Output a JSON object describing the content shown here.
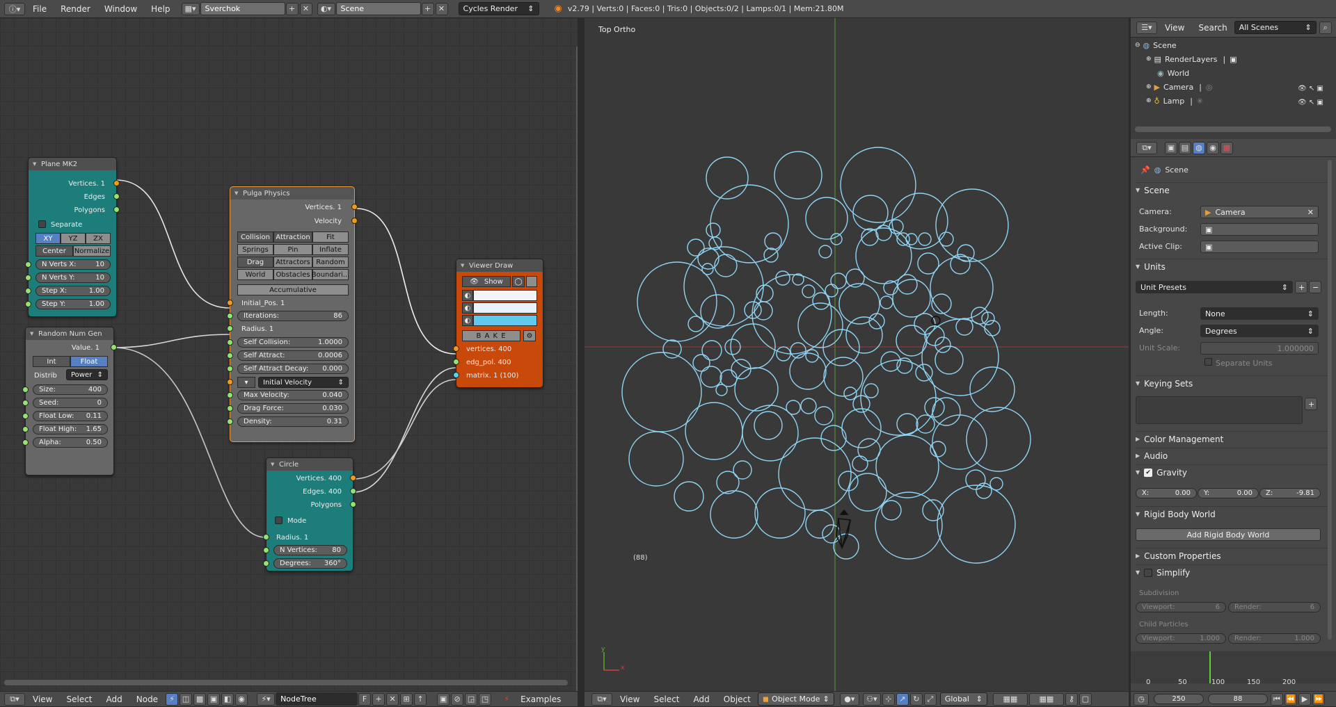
{
  "topbar": {
    "menus": [
      "File",
      "Render",
      "Window",
      "Help"
    ],
    "layout": "Sverchok",
    "scene": "Scene",
    "engine": "Cycles Render",
    "stats": "v2.79 | Verts:0 | Faces:0 | Tris:0 | Objects:0/2 | Lamps:0/1 | Mem:21.80M"
  },
  "nodes": {
    "plane": {
      "title": "Plane MK2",
      "outputs": [
        "Vertices. 1",
        "Edges",
        "Polygons"
      ],
      "separate": "Separate",
      "axes": [
        "XY",
        "YZ",
        "ZX"
      ],
      "modes": [
        "Center",
        "Normalize"
      ],
      "fields": [
        {
          "label": "N Verts X:",
          "value": "10"
        },
        {
          "label": "N Verts Y:",
          "value": "10"
        },
        {
          "label": "Step X:",
          "value": "1.00"
        },
        {
          "label": "Step Y:",
          "value": "1.00"
        }
      ]
    },
    "random": {
      "title": "Random Num Gen",
      "output": "Value. 1",
      "types": [
        "Int",
        "Float"
      ],
      "distrib_label": "Distrib",
      "distrib_value": "Power",
      "fields": [
        {
          "label": "Size:",
          "value": "400"
        },
        {
          "label": "Seed:",
          "value": "0"
        },
        {
          "label": "Float Low:",
          "value": "0.11"
        },
        {
          "label": "Float High:",
          "value": "1.65"
        },
        {
          "label": "Alpha:",
          "value": "0.50"
        }
      ]
    },
    "pulga": {
      "title": "Pulga Physics",
      "outputs": [
        "Vertices. 1",
        "Velocity"
      ],
      "grid": [
        [
          "Collision",
          "Attraction",
          "Fit"
        ],
        [
          "Springs",
          "Pin",
          "Inflate"
        ],
        [
          "Drag",
          "Attractors",
          "Random"
        ],
        [
          "World",
          "Obstacles",
          "Boundari..."
        ]
      ],
      "accumulative": "Accumulative",
      "initial_pos": "Initial_Pos. 1",
      "radius": "Radius. 1",
      "fields": [
        {
          "label": "Iterations:",
          "value": "86"
        },
        {
          "label": "Self Collision:",
          "value": "1.0000"
        },
        {
          "label": "Self Attract:",
          "value": "0.0006"
        },
        {
          "label": "Self Attract Decay:",
          "value": "0.000"
        }
      ],
      "init_vel": "Initial Velocity",
      "fields2": [
        {
          "label": "Max Velocity:",
          "value": "0.040"
        },
        {
          "label": "Drag Force:",
          "value": "0.030"
        },
        {
          "label": "Density:",
          "value": "0.31"
        }
      ]
    },
    "viewer": {
      "title": "Viewer Draw",
      "show": "Show",
      "bake": "B A K E",
      "inputs": [
        "vertices. 400",
        "edg_pol. 400",
        "matrix. 1 (100)"
      ]
    },
    "circle": {
      "title": "Circle",
      "outputs": [
        "Vertices. 400",
        "Edges. 400",
        "Polygons"
      ],
      "mode": "Mode",
      "radius": "Radius. 1",
      "fields": [
        {
          "label": "N Vertices:",
          "value": "80"
        },
        {
          "label": "Degrees:",
          "value": "360°"
        }
      ]
    }
  },
  "node_footer": {
    "menus": [
      "View",
      "Select",
      "Add",
      "Node"
    ],
    "tree": "NodeTree",
    "fake": "F",
    "examples": "Examples"
  },
  "viewport": {
    "label": "Top Ortho",
    "frame": "(88)",
    "menus": [
      "View",
      "Select",
      "Add",
      "Object"
    ],
    "mode": "Object Mode",
    "orientation": "Global",
    "circle_color": "#8fd4f2"
  },
  "outliner": {
    "menus": [
      "View",
      "Search"
    ],
    "filter": "All Scenes",
    "items": [
      "Scene",
      "RenderLayers",
      "World",
      "Camera",
      "Lamp"
    ]
  },
  "properties": {
    "scene_path": "Scene",
    "scene_panel": "Scene",
    "camera_label": "Camera:",
    "camera_value": "Camera",
    "background_label": "Background:",
    "clip_label": "Active Clip:",
    "units_panel": "Units",
    "unit_presets": "Unit Presets",
    "length_label": "Length:",
    "length_value": "None",
    "angle_label": "Angle:",
    "angle_value": "Degrees",
    "scale_label": "Unit Scale:",
    "scale_value": "1.000000",
    "separate_units": "Separate Units",
    "keying_panel": "Keying Sets",
    "color_mgmt": "Color Management",
    "audio": "Audio",
    "gravity": "Gravity",
    "gx": "X:",
    "gx_v": "0.00",
    "gy": "Y:",
    "gy_v": "0.00",
    "gz": "Z:",
    "gz_v": "-9.81",
    "rbw": "Rigid Body World",
    "add_rbw": "Add Rigid Body World",
    "custom": "Custom Properties",
    "simplify": "Simplify",
    "subdivision": "Subdivision",
    "viewport_l": "Viewport:",
    "viewport_v": "6",
    "render_l": "Render:",
    "render_v": "6",
    "child": "Child Particles",
    "cp_viewport_v": "1.000",
    "cp_render_v": "1.000"
  },
  "timeline": {
    "ticks": [
      "0",
      "50",
      "100",
      "150",
      "200"
    ],
    "end": "250",
    "current": "88"
  }
}
